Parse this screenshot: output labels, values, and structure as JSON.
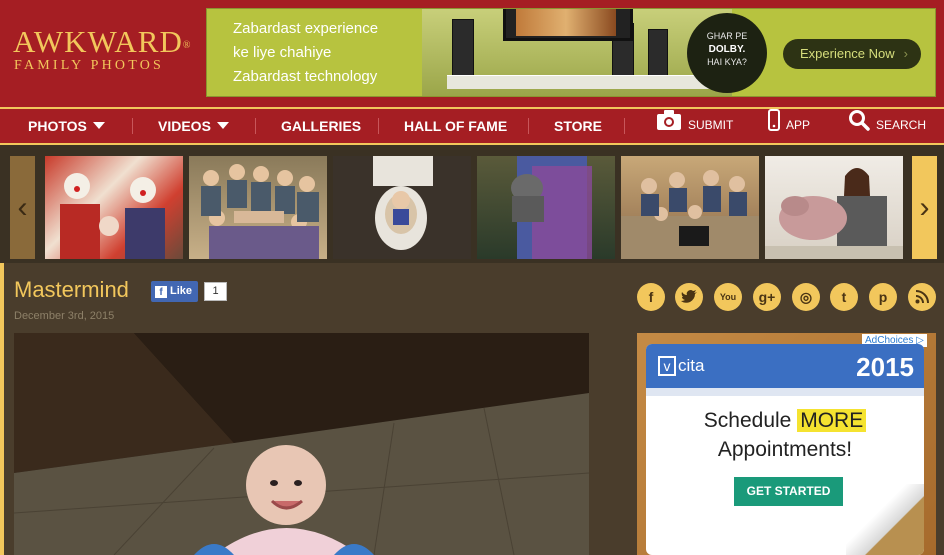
{
  "logo": {
    "main": "AWKWARD",
    "reg": "®",
    "sub": "FAMILY PHOTOS"
  },
  "banner": {
    "lines": [
      "Zabardast experience",
      "ke liye chahiye",
      "Zabardast technology"
    ],
    "circle_top": "GHAR PE",
    "circle_brand": "DOLBY.",
    "circle_bottom": "HAI KYA?",
    "cta": "Experience Now",
    "cta_chevron": "›"
  },
  "nav": {
    "items": [
      {
        "label": "PHOTOS",
        "dropdown": true
      },
      {
        "label": "VIDEOS",
        "dropdown": true
      },
      {
        "label": "GALLERIES"
      },
      {
        "label": "HALL OF FAME"
      },
      {
        "label": "STORE"
      }
    ],
    "submit": "SUBMIT",
    "app": "APP",
    "search": "SEARCH"
  },
  "strip": {
    "prev_arrow": "‹",
    "next_arrow": "›",
    "thumbs": [
      "clowns-icon",
      "family-hands-icon",
      "baby-toilet-icon",
      "woman-cat-icon",
      "family-couch-icon",
      "woman-pig-icon"
    ]
  },
  "post": {
    "title": "Mastermind",
    "like_label": "Like",
    "like_count": "1",
    "date": "December 3rd, 2015"
  },
  "social": [
    {
      "name": "facebook-icon",
      "glyph": "f"
    },
    {
      "name": "twitter-icon",
      "glyph": "t"
    },
    {
      "name": "youtube-icon",
      "glyph": "You"
    },
    {
      "name": "googleplus-icon",
      "glyph": "g+"
    },
    {
      "name": "instagram-icon",
      "glyph": "◎"
    },
    {
      "name": "tumblr-icon",
      "glyph": "t"
    },
    {
      "name": "pinterest-icon",
      "glyph": "p"
    },
    {
      "name": "rss-icon",
      "glyph": ")"
    }
  ],
  "ad": {
    "adchoices": "AdChoices",
    "brand": "cita",
    "brand_v": "v",
    "year": "2015",
    "line1_prefix": "Schedule ",
    "line1_highlight": "MORE",
    "line2": "Appointments!",
    "button": "GET STARTED"
  }
}
